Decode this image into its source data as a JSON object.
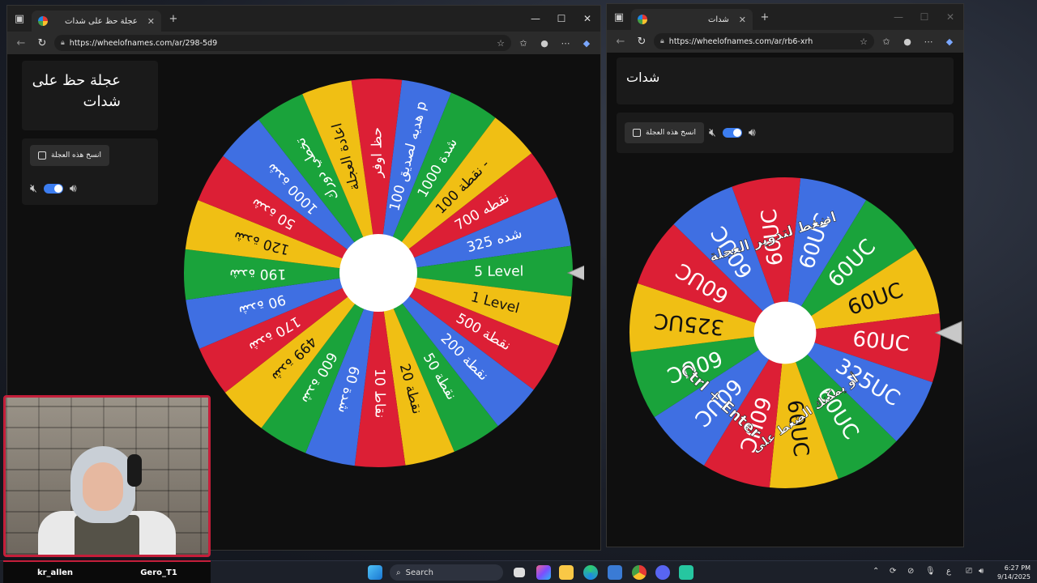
{
  "left_window": {
    "tab_title": "عجلة حظ على شدات",
    "url": "https://wheelofnames.com/ar/298-5d9",
    "wheel_title": "عجلة حظ على شدات",
    "copy_button": "انسخ هذه العجلة",
    "wheel_entries": [
      "حظ اوفر",
      "هديه لصديق 100 p",
      "1000 شدة",
      "نقطة 100 -",
      "نقطه 700",
      "325 شده",
      "5 Level",
      "1 Level",
      "نقطة 500",
      "نقطة 200",
      "نقطة 50",
      "نقطة 20",
      "10 نقاط",
      "60 شدة",
      "600 شدة",
      "499 شدة",
      "170 شدة",
      "90 شدة",
      "190 شدة",
      "120 شدة",
      "50 شدة",
      "1000 شدة",
      "تخطي دورك",
      "اعادة العجلة"
    ]
  },
  "right_window": {
    "tab_title": "شدات",
    "url": "https://wheelofnames.com/ar/rb6-xrh",
    "wheel_title": "شدات",
    "copy_button": "انسخ هذه العجلة",
    "wheel_entries": [
      "60UC",
      "60UC",
      "60UC",
      "60UC",
      "60UC",
      "325UC",
      "60UC",
      "60UC",
      "60UC",
      "60UC",
      "60UC",
      "325UC",
      "60UC",
      "60UC"
    ],
    "overlay_top": "اضغط لتدوير العجلة",
    "overlay_bottom": "أو يمكنك الضغط على",
    "overlay_keys": "Ctrl + Enter"
  },
  "colors": {
    "red": "#dc1f35",
    "blue": "#3f6fe2",
    "green": "#1aa33b",
    "yellow": "#f0bf14"
  },
  "webcam": {
    "name_left": "kr_allen",
    "name_right": "Gero_T1"
  },
  "taskbar": {
    "search_label": "Search",
    "time": "6:27 PM",
    "date": "9/14/2025",
    "lang": "ع"
  }
}
